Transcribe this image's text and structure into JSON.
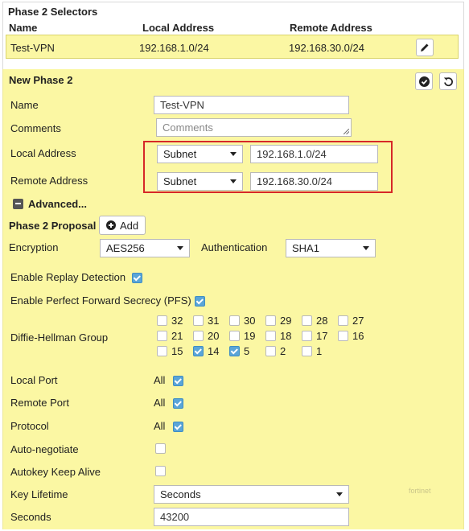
{
  "selectors": {
    "title": "Phase 2 Selectors",
    "columns": [
      "Name",
      "Local Address",
      "Remote Address"
    ],
    "row": {
      "name": "Test-VPN",
      "local": "192.168.1.0/24",
      "remote": "192.168.30.0/24"
    },
    "edit_icon": "pencil-icon"
  },
  "phase2": {
    "title": "New Phase 2",
    "ok_icon": "check-circle-icon",
    "revert_icon": "undo-icon",
    "name_label": "Name",
    "name_value": "Test-VPN",
    "comments_label": "Comments",
    "comments_placeholder": "Comments",
    "local_address_label": "Local Address",
    "local_address_type": "Subnet",
    "local_address_value": "192.168.1.0/24",
    "remote_address_label": "Remote Address",
    "remote_address_type": "Subnet",
    "remote_address_value": "192.168.30.0/24",
    "advanced_label": "Advanced...",
    "proposal_label": "Phase 2 Proposal",
    "add_label": "Add",
    "encryption_label": "Encryption",
    "encryption_value": "AES256",
    "authentication_label": "Authentication",
    "authentication_value": "SHA1",
    "replay_label": "Enable Replay Detection",
    "replay_checked": true,
    "pfs_label": "Enable Perfect Forward Secrecy (PFS)",
    "pfs_checked": true,
    "dh_label": "Diffie-Hellman Group",
    "dh_groups": [
      {
        "value": "32",
        "checked": false
      },
      {
        "value": "31",
        "checked": false
      },
      {
        "value": "30",
        "checked": false
      },
      {
        "value": "29",
        "checked": false
      },
      {
        "value": "28",
        "checked": false
      },
      {
        "value": "27",
        "checked": false
      },
      {
        "value": "21",
        "checked": false
      },
      {
        "value": "20",
        "checked": false
      },
      {
        "value": "19",
        "checked": false
      },
      {
        "value": "18",
        "checked": false
      },
      {
        "value": "17",
        "checked": false
      },
      {
        "value": "16",
        "checked": false
      },
      {
        "value": "15",
        "checked": false
      },
      {
        "value": "14",
        "checked": true
      },
      {
        "value": "5",
        "checked": true
      },
      {
        "value": "2",
        "checked": false
      },
      {
        "value": "1",
        "checked": false
      }
    ],
    "local_port_label": "Local Port",
    "local_port_value": "All",
    "local_port_checked": true,
    "remote_port_label": "Remote Port",
    "remote_port_value": "All",
    "remote_port_checked": true,
    "protocol_label": "Protocol",
    "protocol_value": "All",
    "protocol_checked": true,
    "auto_negotiate_label": "Auto-negotiate",
    "auto_negotiate_checked": false,
    "keep_alive_label": "Autokey Keep Alive",
    "keep_alive_checked": false,
    "key_lifetime_label": "Key Lifetime",
    "key_lifetime_value": "Seconds",
    "seconds_label": "Seconds",
    "seconds_value": "43200",
    "watermark": "fortinet"
  }
}
